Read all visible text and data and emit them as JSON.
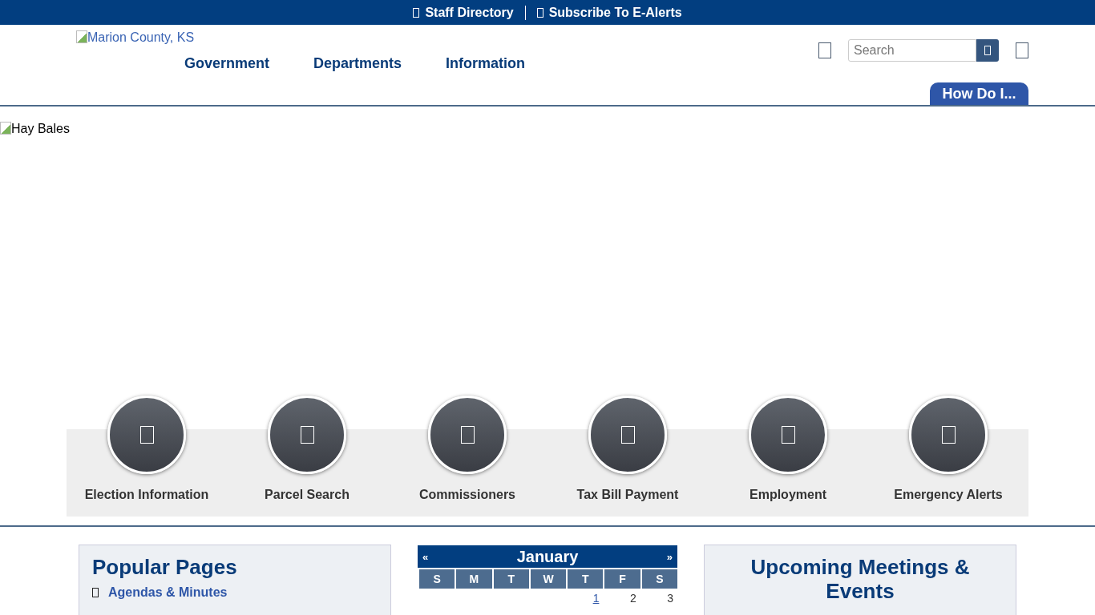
{
  "top_bar": {
    "links": [
      {
        "label": "Staff Directory"
      },
      {
        "label": "Subscribe To E-Alerts"
      }
    ]
  },
  "header": {
    "logo_alt": "Marion County, KS",
    "nav": [
      {
        "label": "Government"
      },
      {
        "label": "Departments"
      },
      {
        "label": "Information"
      }
    ],
    "search": {
      "placeholder": "Search"
    },
    "how_do_i": "How Do I..."
  },
  "hero": {
    "image_alt": "Hay Bales"
  },
  "quick_links": [
    {
      "label": "Election Information"
    },
    {
      "label": "Parcel Search"
    },
    {
      "label": "Commissioners"
    },
    {
      "label": "Tax Bill Payment"
    },
    {
      "label": "Employment"
    },
    {
      "label": "Emergency Alerts"
    }
  ],
  "popular_pages": {
    "title": "Popular Pages",
    "items": [
      {
        "label": "Agendas & Minutes"
      }
    ]
  },
  "calendar": {
    "prev": "«",
    "month": "January",
    "next": "»",
    "weekdays": [
      "S",
      "M",
      "T",
      "W",
      "T",
      "F",
      "S"
    ],
    "days": [
      {
        "label": "1",
        "link": true
      },
      {
        "label": "2",
        "link": false
      },
      {
        "label": "3",
        "link": false
      }
    ]
  },
  "events": {
    "title": "Upcoming Meetings & Events"
  }
}
